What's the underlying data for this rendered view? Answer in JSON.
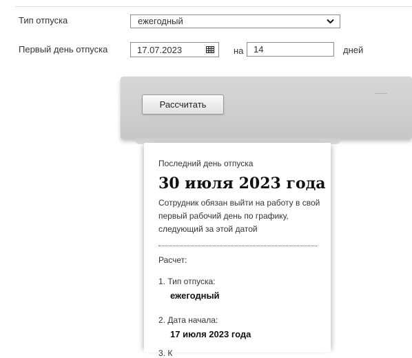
{
  "form": {
    "vacation_type_label": "Тип отпуска",
    "vacation_type_value": "ежегодный",
    "first_day_label": "Первый день отпуска",
    "first_day_value": "17.07.2023",
    "na_label": "на",
    "days_value": "14",
    "days_label": "дней"
  },
  "action": {
    "calculate_label": "Рассчитать"
  },
  "result": {
    "caption": "Последний день отпуска",
    "date": "30 июля 2023 года",
    "note": "Сотрудник обязан выйти на работу в свой первый рабочий день по графику, следующий за этой датой",
    "calc_header": "Расчет:",
    "item1_label": "1. Тип отпуска:",
    "item1_value": "ежегодный",
    "item2_label": "2. Дата начала:",
    "item2_value": "17 июля 2023 года",
    "item3_partial": "3. К"
  },
  "icons": {
    "select_arrow": "chevron-down-icon",
    "calendar": "calendar-icon"
  },
  "colors": {
    "panel": "#cfcfcf",
    "border": "#8a8a8a",
    "text": "#333333"
  }
}
